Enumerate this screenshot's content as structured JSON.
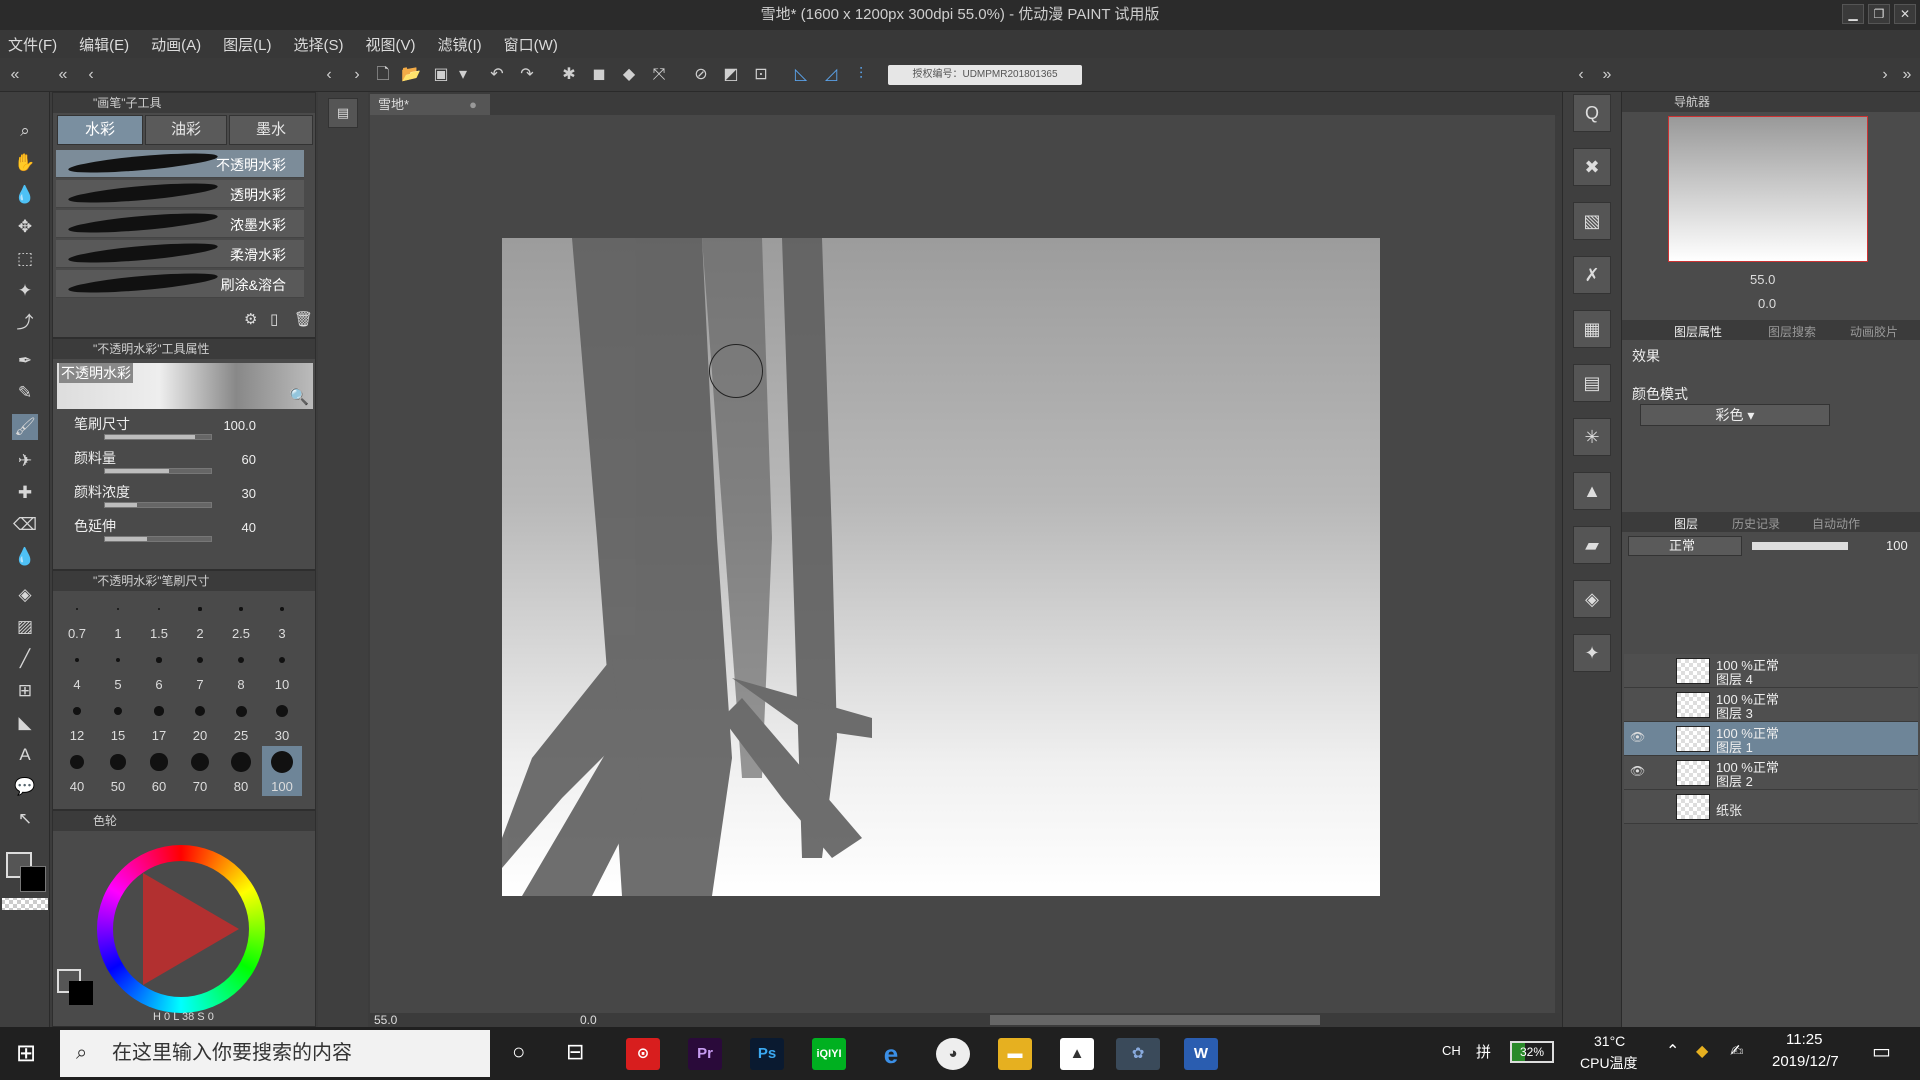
{
  "window": {
    "title": "雪地* (1600 x 1200px 300dpi 55.0%)  - 优动漫 PAINT 试用版",
    "controls": [
      "▁",
      "❐",
      "✕"
    ]
  },
  "menu": [
    "文件(F)",
    "编辑(E)",
    "动画(A)",
    "图层(L)",
    "选择(S)",
    "视图(V)",
    "滤镜(I)",
    "窗口(W)"
  ],
  "license": "授权编号：UDMPMR201801365",
  "doc_tab": "雪地*",
  "brush_panel": {
    "title": "\"画笔\"子工具",
    "tabs": [
      "水彩",
      "油彩",
      "墨水"
    ],
    "brushes": [
      "不透明水彩",
      "透明水彩",
      "浓墨水彩",
      "柔滑水彩",
      "刷涂&溶合"
    ]
  },
  "tool_props": {
    "title": "\"不透明水彩\"工具属性",
    "preview_label": "不透明水彩",
    "rows": [
      {
        "label": "笔刷尺寸",
        "value": "100.0",
        "fill": 0.85
      },
      {
        "label": "颜料量",
        "value": "60",
        "fill": 0.6
      },
      {
        "label": "颜料浓度",
        "value": "30",
        "fill": 0.3
      },
      {
        "label": "色延伸",
        "value": "40",
        "fill": 0.4
      }
    ]
  },
  "brush_size": {
    "title": "\"不透明水彩\"笔刷尺寸",
    "sizes": [
      "0.7",
      "1",
      "1.5",
      "2",
      "2.5",
      "3",
      "4",
      "5",
      "6",
      "7",
      "8",
      "10",
      "12",
      "15",
      "17",
      "20",
      "25",
      "30",
      "40",
      "50",
      "60",
      "70",
      "80",
      "100"
    ]
  },
  "color_panel": {
    "title": "色轮",
    "readout": [
      "H",
      "0",
      "L",
      "38",
      "S",
      "0"
    ]
  },
  "status": {
    "zoom": "55.0",
    "angle": "0.0"
  },
  "navigator": {
    "title": "导航器",
    "zoom": "55.0",
    "rotate": "0.0"
  },
  "layer_props": {
    "tabs": [
      "图层属性",
      "图层搜索",
      "动画胶片"
    ],
    "effect_label": "效果",
    "color_mode_label": "颜色模式",
    "color_mode_value": "彩色"
  },
  "layers_panel": {
    "tabs": [
      "图层",
      "历史记录",
      "自动动作"
    ],
    "blend": "正常",
    "opacity": "100",
    "layers": [
      {
        "percent": "100 %正常",
        "name": "图层 4",
        "selected": false,
        "visible": false
      },
      {
        "percent": "100 %正常",
        "name": "图层 3",
        "selected": false,
        "visible": false
      },
      {
        "percent": "100 %正常",
        "name": "图层 1",
        "selected": true,
        "visible": true
      },
      {
        "percent": "100 %正常",
        "name": "图层 2",
        "selected": false,
        "visible": true
      },
      {
        "percent": "",
        "name": "纸张",
        "selected": false,
        "visible": false
      }
    ]
  },
  "taskbar": {
    "search_placeholder": "在这里输入你要搜索的内容",
    "apps": [
      "网易云",
      "Pr",
      "Ps",
      "iQIYI",
      "e",
      "企鹅",
      "文件夹",
      "照片",
      "优动漫",
      "W"
    ],
    "ime": "CH",
    "ime2": "拼",
    "battery": "32%",
    "temp": "31°C",
    "temp_label": "CPU温度",
    "time": "11:25",
    "date": "2019/12/7"
  }
}
